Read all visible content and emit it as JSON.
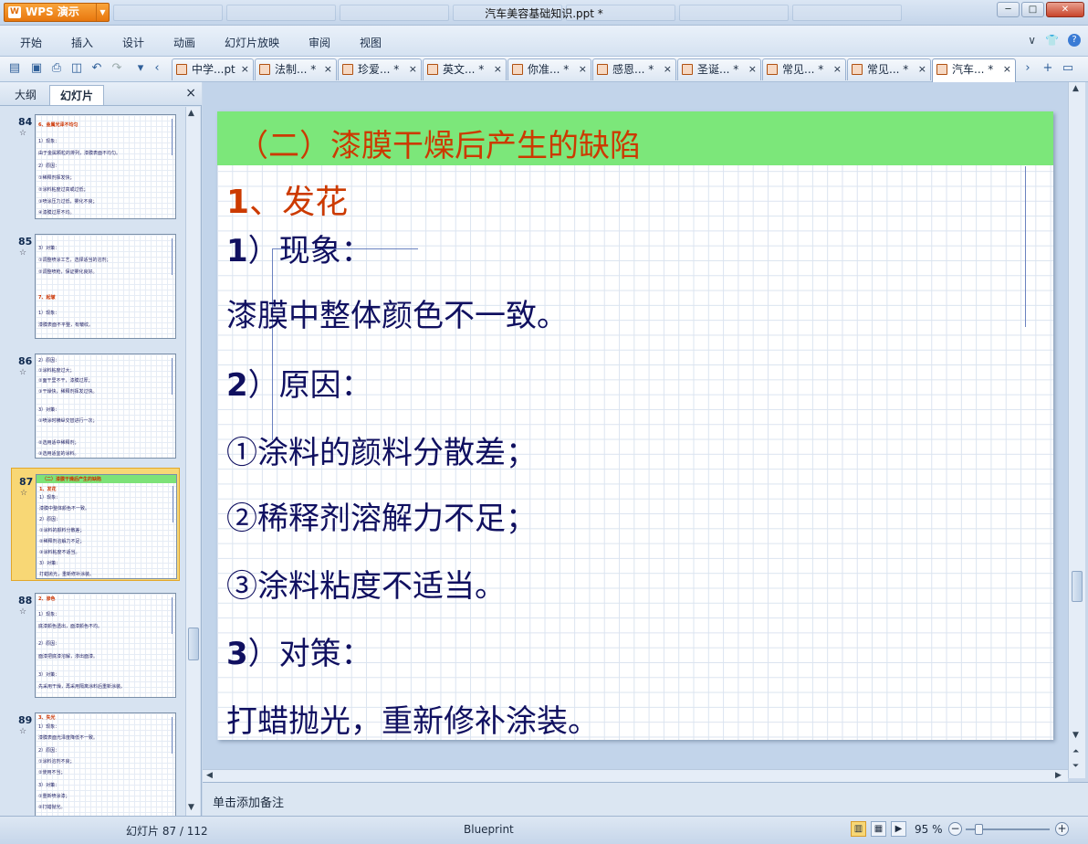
{
  "titlebar": {
    "app_name": "WPS 演示",
    "title": "汽车美容基础知识.ppt *",
    "minimize": "─",
    "maximize": "□",
    "close": "✕"
  },
  "menu": {
    "items": [
      "开始",
      "插入",
      "设计",
      "动画",
      "幻灯片放映",
      "审阅",
      "视图"
    ],
    "right": [
      "∨",
      "👕",
      "?"
    ]
  },
  "doc_tabs": [
    {
      "label": "中学...pt",
      "close": "×"
    },
    {
      "label": "法制... *",
      "close": "×"
    },
    {
      "label": "珍爱... *",
      "close": "×"
    },
    {
      "label": "英文... *",
      "close": "×"
    },
    {
      "label": "你准... *",
      "close": "×"
    },
    {
      "label": "感恩... *",
      "close": "×"
    },
    {
      "label": "圣诞... *",
      "close": "×"
    },
    {
      "label": "常见... *",
      "close": "×"
    },
    {
      "label": "常见... *",
      "close": "×"
    },
    {
      "label": "汽车... *",
      "close": "×"
    }
  ],
  "left_panel": {
    "tabs": [
      "大纲",
      "幻灯片"
    ],
    "close": "×",
    "slides": [
      {
        "num": "84",
        "lines": [
          "6、金属光泽不均匀",
          "1）现象：",
          "由于金属颗粒的排列，漆膜表面不均匀。",
          "2）原因：",
          "①稀释剂挥发快；",
          "②涂料粘度过高或过低；",
          "③喷涂压力过低，雾化不良；",
          "④漆膜过厚不均。"
        ]
      },
      {
        "num": "85",
        "lines": [
          "3）对策：",
          "①调整喷涂工艺，选择适当的溶剂；",
          "②调整喷枪，保证雾化良好。",
          "",
          "7、起皱",
          "1）现象：",
          "漆膜表面不平整，有皱纹。"
        ]
      },
      {
        "num": "86",
        "lines": [
          "2）原因：",
          "①涂料粘度过大；",
          "②面干里不干，漆膜过厚；",
          "③干燥快，稀释剂挥发过快。",
          "",
          "3）对策：",
          "①喷涂时横纵交替进行一次；",
          "②选用适中稀释剂；",
          "③选用适宜的涂料。"
        ]
      },
      {
        "num": "87",
        "lines": [
          "（二）漆膜干燥后产生的缺陷",
          "1、发花",
          "1）现象：",
          "漆膜中整体颜色不一致。",
          "2）原因：",
          "①涂料的颜料分散差；",
          "②稀释剂溶解力不足；",
          "③涂料粘度不适当。",
          "3）对策：",
          "打蜡抛光，重新修补涂装。"
        ]
      },
      {
        "num": "88",
        "lines": [
          "2、渗色",
          "1）现象：",
          "底漆颜色透出，面漆颜色不均。",
          "2）原因：",
          "面漆把底漆溶解，渗出面漆。",
          "",
          "3）对策：",
          "先采用干燥，再采用隔离涂料后重新涂装。"
        ]
      },
      {
        "num": "89",
        "lines": [
          "3、失光",
          "1）现象：",
          "漆膜表面光泽度降低不一致。",
          "2）原因：",
          "①涂料溶剂不良；",
          "②使用不当；",
          "3）对策：",
          "①重新喷涂漆；",
          "②打蜡抛光。"
        ]
      }
    ]
  },
  "slide": {
    "title": "（二）漆膜干燥后产生的缺陷",
    "heading": "1、发花",
    "heading_num": "1",
    "heading_text": "、发花",
    "s1_num": "1",
    "s1_text": "）现象：",
    "s1_body": "漆膜中整体颜色不一致。",
    "s2_num": "2",
    "s2_text": "）原因：",
    "s2_items": [
      "①涂料的颜料分散差；",
      "②稀释剂溶解力不足；",
      "③涂料粘度不适当。"
    ],
    "s3_num": "3",
    "s3_text": "）对策：",
    "s3_body": "打蜡抛光，重新修补涂装。"
  },
  "notes": {
    "placeholder": "单击添加备注"
  },
  "status": {
    "slide_count": "幻灯片 87 / 112",
    "theme": "Blueprint",
    "zoom": "95 %",
    "zoom_minus": "−",
    "zoom_plus": "+"
  },
  "colors": {
    "title_bar": "#7ce77a",
    "accent_red": "#cc3a00",
    "text_navy": "#101060",
    "selection": "#f8d775"
  }
}
